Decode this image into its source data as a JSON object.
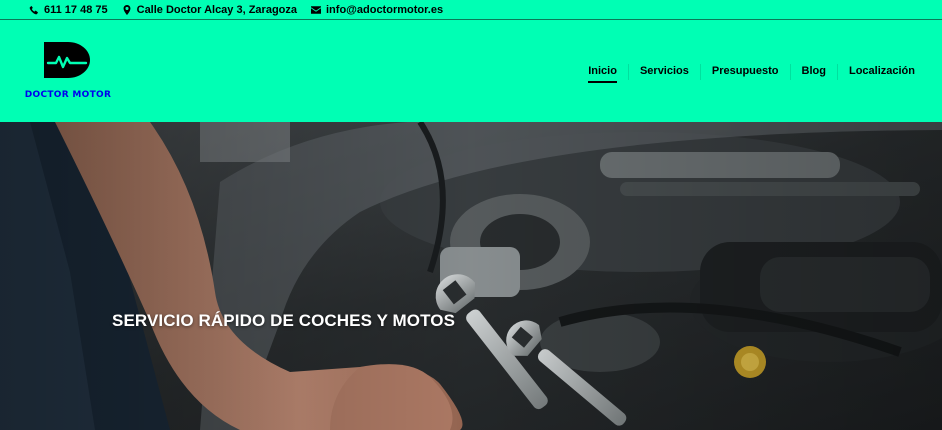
{
  "contact": {
    "phone": "611 17 48 75",
    "address": "Calle Doctor Alcay 3, Zaragoza",
    "email": "info@adoctormotor.es",
    "phone_icon": "phone-icon",
    "address_icon": "map-pin-icon",
    "email_icon": "envelope-icon"
  },
  "brand": {
    "name": "DOCTOR MOTOR",
    "logo_icon": "doctor-motor-logo"
  },
  "nav": {
    "items": [
      {
        "label": "Inicio",
        "active": true
      },
      {
        "label": "Servicios",
        "active": false
      },
      {
        "label": "Presupuesto",
        "active": false
      },
      {
        "label": "Blog",
        "active": false
      },
      {
        "label": "Localización",
        "active": false
      }
    ]
  },
  "hero": {
    "title": "SERVICIO RÁPIDO DE COCHES Y MOTOS"
  },
  "colors": {
    "accent": "#00ffb4",
    "text": "#000000",
    "hero_text": "#ffffff"
  }
}
